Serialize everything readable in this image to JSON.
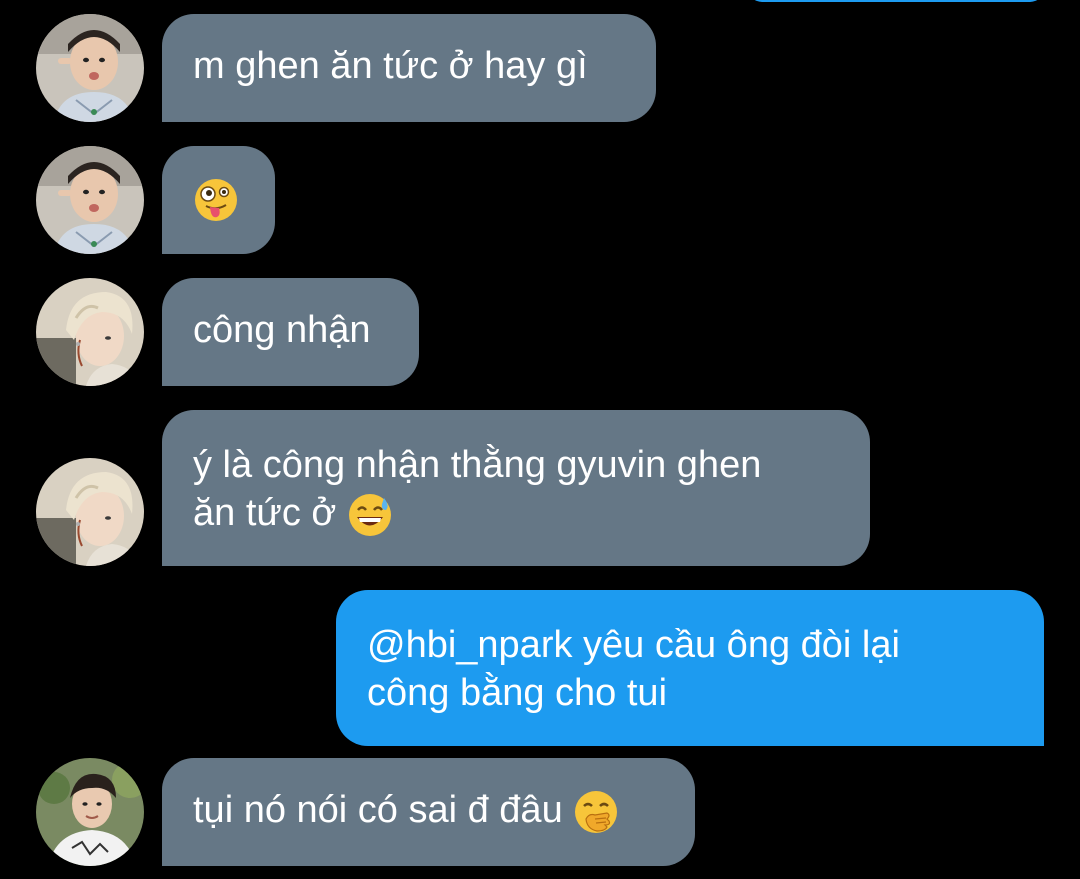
{
  "colors": {
    "background": "#000000",
    "incoming_bubble": "#657786",
    "outgoing_bubble": "#1d9bf0",
    "text": "#ffffff"
  },
  "messages": [
    {
      "direction": "incoming",
      "sender_avatar": "avatar-user-a",
      "text": "m ghen ăn tức ở hay gì"
    },
    {
      "direction": "incoming",
      "sender_avatar": "avatar-user-a",
      "emoji": "zany-face"
    },
    {
      "direction": "incoming",
      "sender_avatar": "avatar-user-b",
      "text": "công nhận"
    },
    {
      "direction": "incoming",
      "sender_avatar": "avatar-user-b",
      "text_line1": "ý là công nhận thằng gyuvin ghen",
      "text_line2": "ăn tức ở",
      "emoji": "grinning-face-with-sweat"
    },
    {
      "direction": "outgoing",
      "text_line1": "@hbi_npark yêu cầu ông đòi lại",
      "text_line2": "công bằng cho tui"
    },
    {
      "direction": "incoming",
      "sender_avatar": "avatar-user-c",
      "text": "tụi nó nói có sai đ đâu",
      "emoji": "face-with-hand-over-mouth"
    }
  ]
}
